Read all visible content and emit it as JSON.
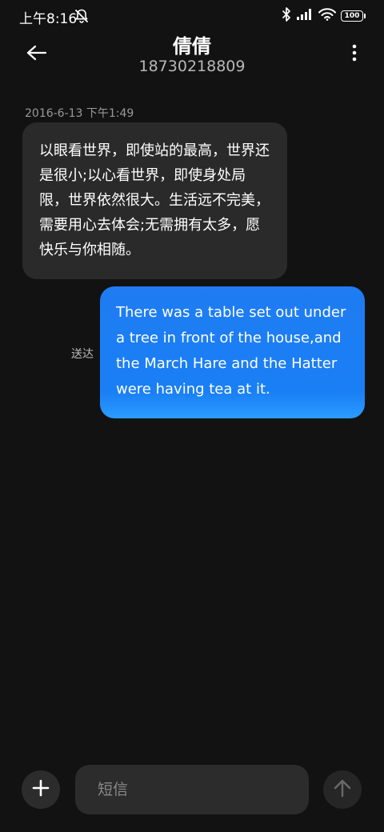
{
  "status_bar": {
    "time": "上午8:16",
    "battery": "100"
  },
  "header": {
    "contact_name": "倩倩",
    "contact_number": "18730218809"
  },
  "conversation": {
    "timestamp": "2016-6-13 下午1:49",
    "incoming_message": "以眼看世界，即使站的最高，世界还是很小;以心看世界，即使身处局限，世界依然很大。生活远不完美，需要用心去体会;无需拥有太多，愿快乐与你相随。",
    "outgoing_message": "There was a table set out under a tree in front of the house,and the March Hare and the Hatter were having tea at it.",
    "outgoing_status": "送达"
  },
  "composer": {
    "placeholder": "短信"
  },
  "colors": {
    "background": "#121212",
    "incoming_bubble": "#2a2a2a",
    "outgoing_bubble": "#1f7cf2"
  },
  "icons": {
    "back": "arrow-left-icon",
    "more": "more-vertical-icon",
    "add": "plus-icon",
    "send": "arrow-up-icon",
    "mute": "mute-bell-icon",
    "bluetooth": "bluetooth-icon",
    "signal": "signal-icon",
    "wifi": "wifi-icon",
    "battery": "battery-icon"
  }
}
